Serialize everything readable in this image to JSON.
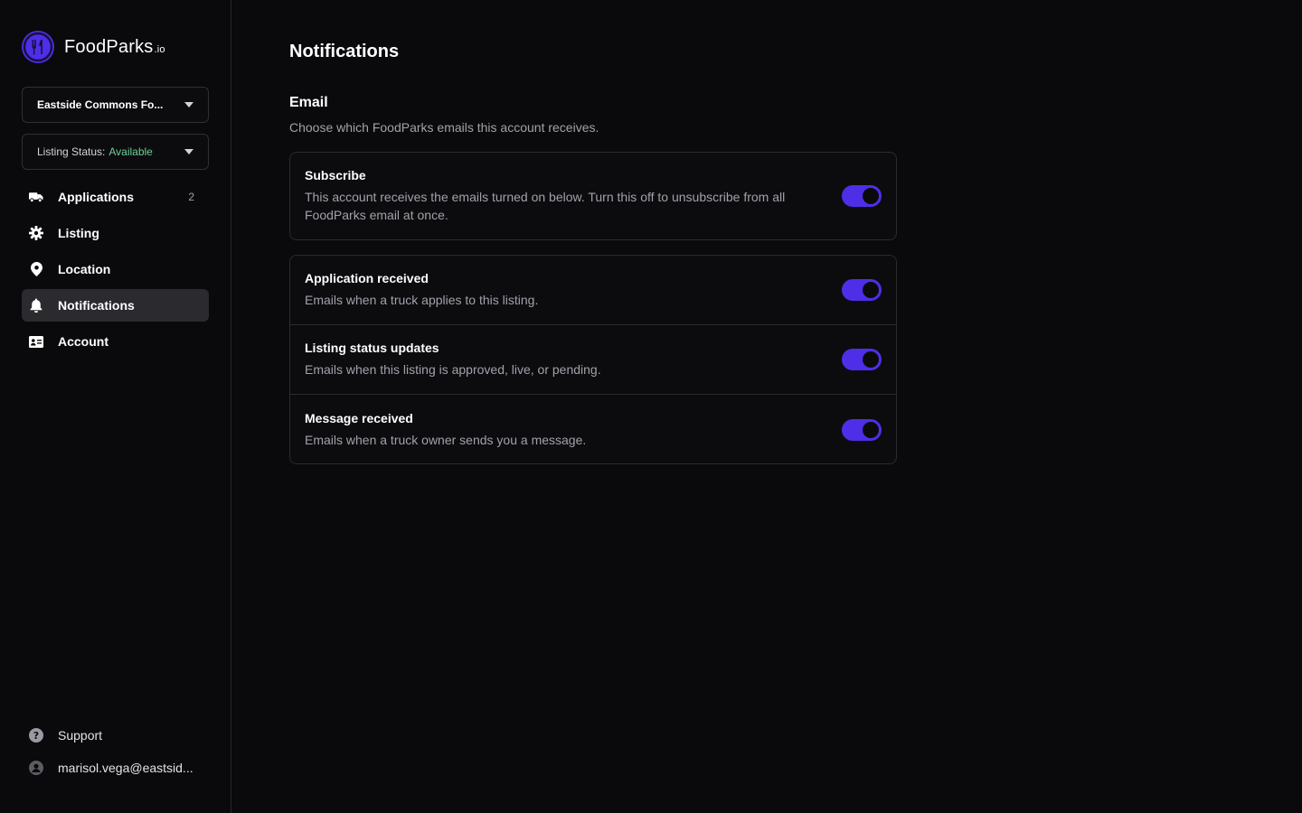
{
  "brand": {
    "name": "FoodParks",
    "tld": ".io"
  },
  "sidebar": {
    "park_select": {
      "value": "Eastside Commons Fo..."
    },
    "status_select": {
      "label": "Listing Status:",
      "value": "Available"
    },
    "items": [
      {
        "label": "Applications",
        "count": "2",
        "icon": "truck-icon"
      },
      {
        "label": "Listing",
        "icon": "gear-icon"
      },
      {
        "label": "Location",
        "icon": "map-pin-icon"
      },
      {
        "label": "Notifications",
        "icon": "bell-icon",
        "active": true
      },
      {
        "label": "Account",
        "icon": "id-card-icon"
      }
    ],
    "support": {
      "label": "Support",
      "icon": "help-circle-icon"
    },
    "user": {
      "email": "marisol.vega@eastsid...",
      "icon": "user-avatar-icon"
    }
  },
  "main": {
    "title": "Notifications",
    "email_section": {
      "title": "Email",
      "description": "Choose which FoodParks emails this account receives."
    },
    "subscribe": {
      "title": "Subscribe",
      "description": "This account receives the emails turned on below. Turn this off to unsubscribe from all FoodParks email at once.",
      "enabled": true
    },
    "settings": [
      {
        "title": "Application received",
        "description": "Emails when a truck applies to this listing.",
        "enabled": true
      },
      {
        "title": "Listing status updates",
        "description": "Emails when this listing is approved, live, or pending.",
        "enabled": true
      },
      {
        "title": "Message received",
        "description": "Emails when a truck owner sends you a message.",
        "enabled": true
      }
    ]
  },
  "colors": {
    "accent": "#4f2ee8",
    "background": "#0a0a0d",
    "status_available": "#6fcf97"
  }
}
